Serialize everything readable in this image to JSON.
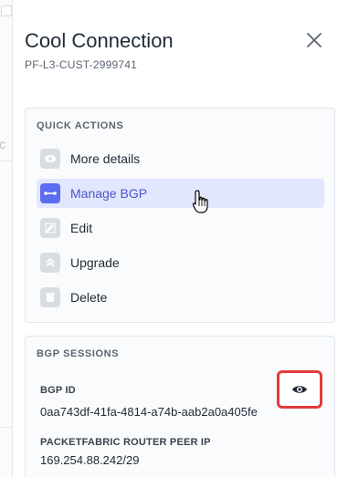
{
  "panel": {
    "title": "Cool Connection",
    "subtitle": "PF-L3-CUST-2999741"
  },
  "background": {
    "partial_letter": "c"
  },
  "quick_actions": {
    "title": "QUICK ACTIONS",
    "items": [
      {
        "label": "More details",
        "icon": "eye-icon"
      },
      {
        "label": "Manage BGP",
        "icon": "double-arrow-icon",
        "active": true
      },
      {
        "label": "Edit",
        "icon": "pencil-icon"
      },
      {
        "label": "Upgrade",
        "icon": "chevrons-up-icon"
      },
      {
        "label": "Delete",
        "icon": "trash-icon"
      }
    ]
  },
  "bgp_sessions": {
    "title": "BGP SESSIONS",
    "bgp_id_label": "BGP ID",
    "bgp_id_value": "0aa743df-41fa-4814-a74b-aab2a0a405fe",
    "peer_ip_label": "PACKETFABRIC ROUTER PEER IP",
    "peer_ip_value": "169.254.88.242/29"
  },
  "colors": {
    "accent": "#5b6cf0",
    "active_bg": "#e3e6ff",
    "highlight_border": "#e23b3b"
  }
}
